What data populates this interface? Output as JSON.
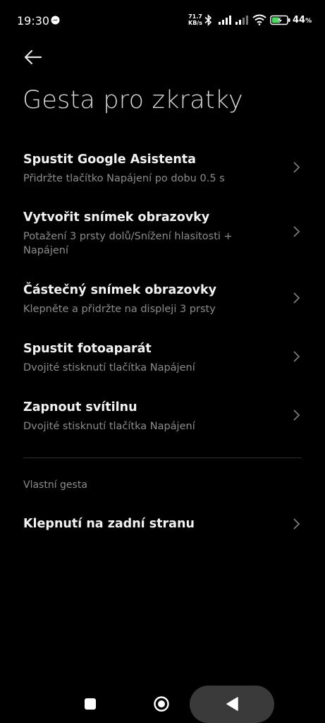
{
  "status_bar": {
    "time": "19:30",
    "net_speed_value": "71.7",
    "net_speed_unit": "KB/s",
    "battery": "44",
    "battery_unit": "%",
    "icons": [
      "messenger-icon",
      "bluetooth-icon",
      "signal-icon",
      "signal-icon",
      "wifi-icon",
      "battery-charging-icon"
    ]
  },
  "header": {
    "back_icon": "arrow-left-icon",
    "title": "Gesta pro zkratky"
  },
  "items": [
    {
      "title": "Spustit Google Asistenta",
      "subtitle": "Přidržte tlačítko Napájení po dobu 0.5 s"
    },
    {
      "title": "Vytvořit snímek obrazovky",
      "subtitle": "Potažení 3 prsty dolů/Snížení hlasitosti + Napájení"
    },
    {
      "title": "Částečný snímek obrazovky",
      "subtitle": "Klepněte a přidržte na displeji 3 prsty"
    },
    {
      "title": "Spustit fotoaparát",
      "subtitle": "Dvojité stisknutí tlačítka Napájení"
    },
    {
      "title": "Zapnout svítilnu",
      "subtitle": "Dvojité stisknutí tlačítka Napájení"
    }
  ],
  "custom_section": {
    "label": "Vlastní gesta",
    "items": [
      {
        "title": "Klepnutí na zadní stranu"
      }
    ]
  },
  "nav_bar": {
    "icons": [
      "recents-square-icon",
      "home-circle-icon",
      "back-triangle-icon"
    ]
  },
  "colors": {
    "background": "#000000",
    "title": "#d6d6d6",
    "item_title": "#f2f2f2",
    "subtitle": "#8c8c8c",
    "nav_pill": "#3a3a3a"
  }
}
